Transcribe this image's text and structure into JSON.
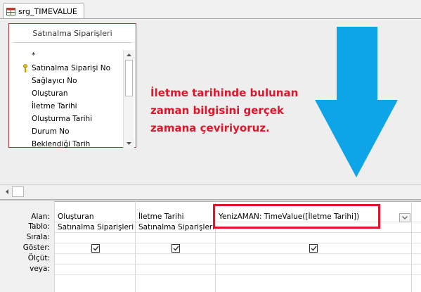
{
  "tab": {
    "label": "srg_TIMEVALUE"
  },
  "table": {
    "title": "Satınalma Siparişleri",
    "fields": [
      "*",
      "Satınalma Siparişi No",
      "Sağlayıcı No",
      "Oluşturan",
      "İletme Tarihi",
      "Oluşturma Tarihi",
      "Durum No",
      "Beklendiği Tarih"
    ]
  },
  "note": {
    "line1": "İletme tarihinde bulunan",
    "line2": "zaman bilgisini gerçek",
    "line3": "zamana çeviriyoruz."
  },
  "grid": {
    "row_labels": {
      "field": "Alan:",
      "table": "Tablo:",
      "sort": "Sırala:",
      "show": "Göster:",
      "criteria": "Ölçüt:",
      "or": "veya:"
    },
    "columns": [
      {
        "field": "Oluşturan",
        "table": "Satınalma Siparişleri",
        "show": true
      },
      {
        "field": "İletme Tarihi",
        "table": "Satınalma Siparişleri",
        "show": true
      },
      {
        "field": "YenizAMAN: TimeValue([İletme Tarihi])",
        "table": "",
        "show": true
      }
    ]
  },
  "colors": {
    "note_text": "#e0152b",
    "highlight": "#e0152b",
    "arrow": "#0ea5e8",
    "table_border": "#a03b3b"
  }
}
